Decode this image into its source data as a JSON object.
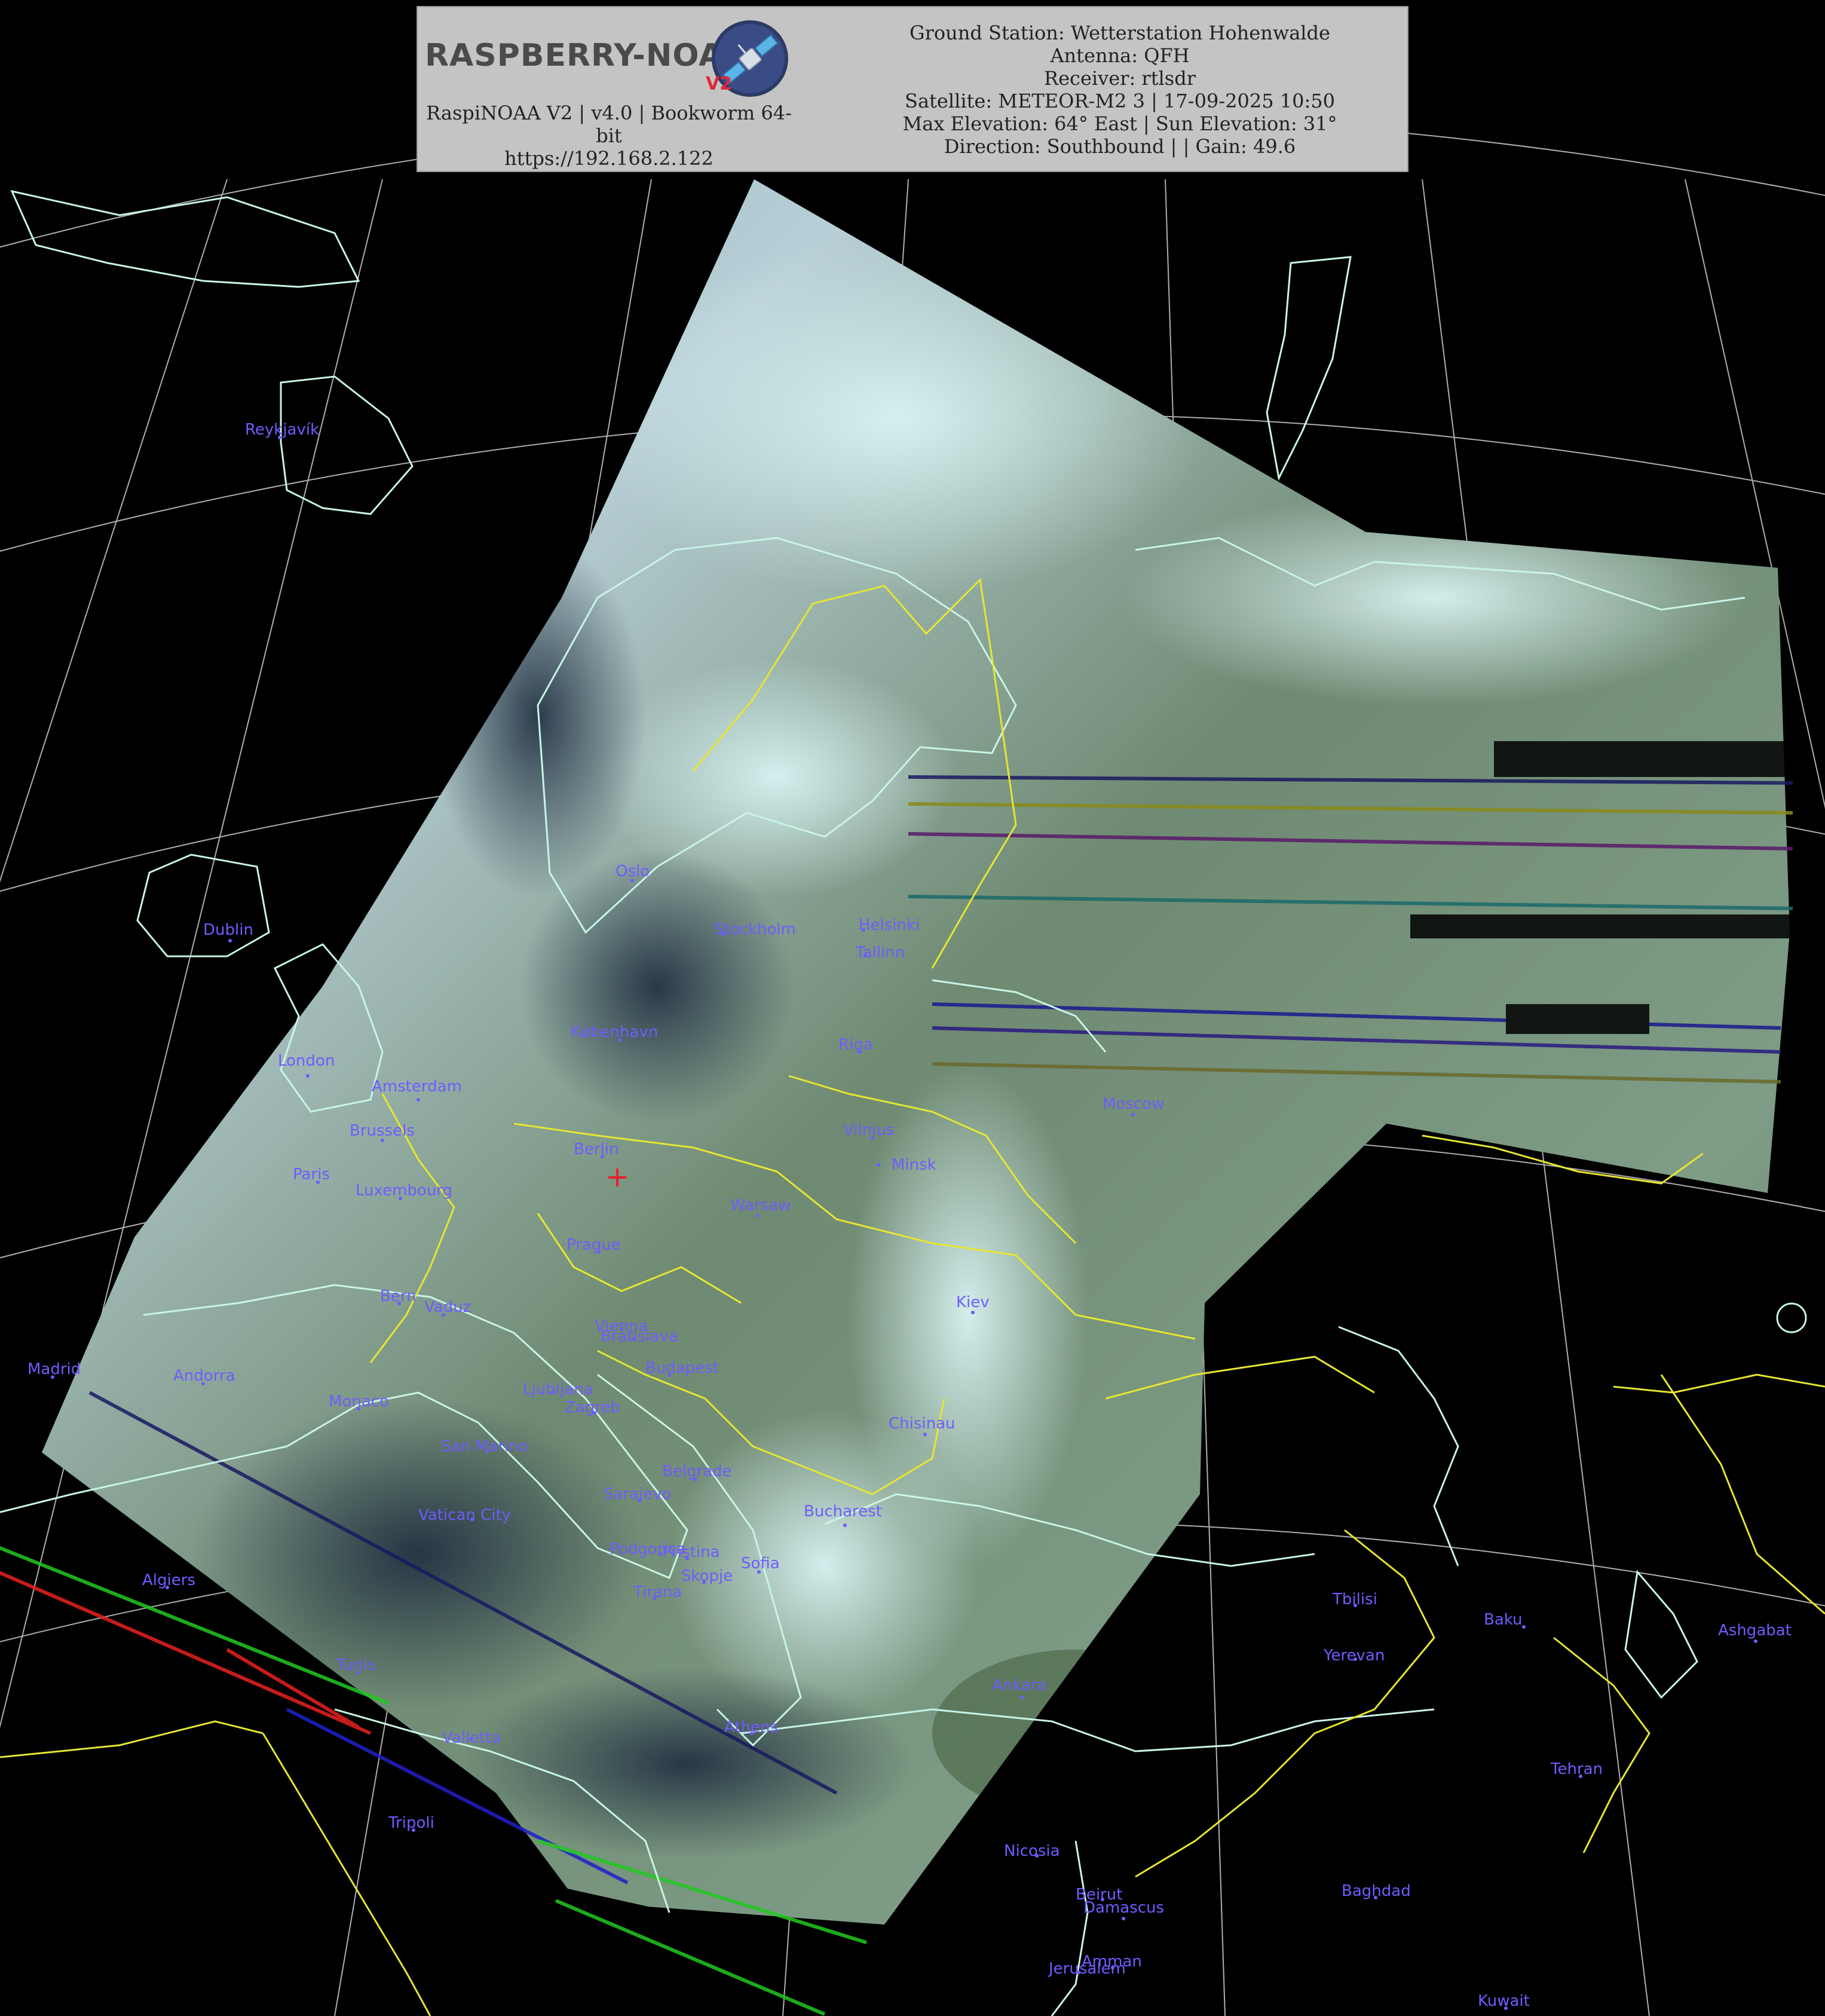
{
  "header": {
    "logo": {
      "text": "RASPBERRY-NOAA",
      "version_badge": "V2"
    },
    "system_line": "RaspiNOAA V2 | v4.0 | Bookworm 64-bit",
    "url": "https://192.168.2.122",
    "ground_station": "Ground Station: Wetterstation Hohenwalde",
    "antenna": "Antenna: QFH",
    "receiver": "Receiver: rtlsdr",
    "satellite": "Satellite: METEOR-M2 3 | 17-09-2025 10:50",
    "elevation": "Max Elevation: 64° East | Sun Elevation: 31°",
    "direction": "Direction: Southbound | | Gain: 49.6"
  },
  "colors": {
    "background": "#000000",
    "coastline": "#c8f5e6",
    "borders": "#e6e632",
    "graticule": "#e8e8e8",
    "city_label": "#6f5cff",
    "station_marker": "#e8202a",
    "header_bg": "#c4c4c4"
  },
  "map": {
    "station_marker_icon": "red-cross-marker",
    "cities": [
      {
        "name": "Reykjavík"
      },
      {
        "name": "Dublin"
      },
      {
        "name": "London"
      },
      {
        "name": "Amsterdam"
      },
      {
        "name": "Brussels"
      },
      {
        "name": "Paris"
      },
      {
        "name": "Luxembourg"
      },
      {
        "name": "Oslo"
      },
      {
        "name": "Stockholm"
      },
      {
        "name": "Helsinki"
      },
      {
        "name": "Tallinn"
      },
      {
        "name": "København"
      },
      {
        "name": "Riga"
      },
      {
        "name": "Vilnius"
      },
      {
        "name": "Minsk"
      },
      {
        "name": "Berlin"
      },
      {
        "name": "Warsaw"
      },
      {
        "name": "Prague"
      },
      {
        "name": "Moscow"
      },
      {
        "name": "Kiev"
      },
      {
        "name": "Bern"
      },
      {
        "name": "Vaduz"
      },
      {
        "name": "Vienna"
      },
      {
        "name": "Bratislava"
      },
      {
        "name": "Budapest"
      },
      {
        "name": "Madrid"
      },
      {
        "name": "Andorra"
      },
      {
        "name": "Monaco"
      },
      {
        "name": "Ljubljana"
      },
      {
        "name": "Zagreb"
      },
      {
        "name": "San Marino"
      },
      {
        "name": "Chisinau"
      },
      {
        "name": "Belgrade"
      },
      {
        "name": "Sarajevo"
      },
      {
        "name": "Vatican City"
      },
      {
        "name": "Bucharest"
      },
      {
        "name": "Podgorica"
      },
      {
        "name": "Pristina"
      },
      {
        "name": "Sofia"
      },
      {
        "name": "Skopje"
      },
      {
        "name": "Tirana"
      },
      {
        "name": "Algiers"
      },
      {
        "name": "Tunis"
      },
      {
        "name": "Valletta"
      },
      {
        "name": "Athens"
      },
      {
        "name": "Ankara"
      },
      {
        "name": "Tbilisi"
      },
      {
        "name": "Yerevan"
      },
      {
        "name": "Baku"
      },
      {
        "name": "Ashgabat"
      },
      {
        "name": "Tehran"
      },
      {
        "name": "Tripoli"
      },
      {
        "name": "Nicosia"
      },
      {
        "name": "Beirut"
      },
      {
        "name": "Damascus"
      },
      {
        "name": "Baghdad"
      },
      {
        "name": "Amman"
      },
      {
        "name": "Jerusalem"
      },
      {
        "name": "Kuwait"
      }
    ]
  }
}
